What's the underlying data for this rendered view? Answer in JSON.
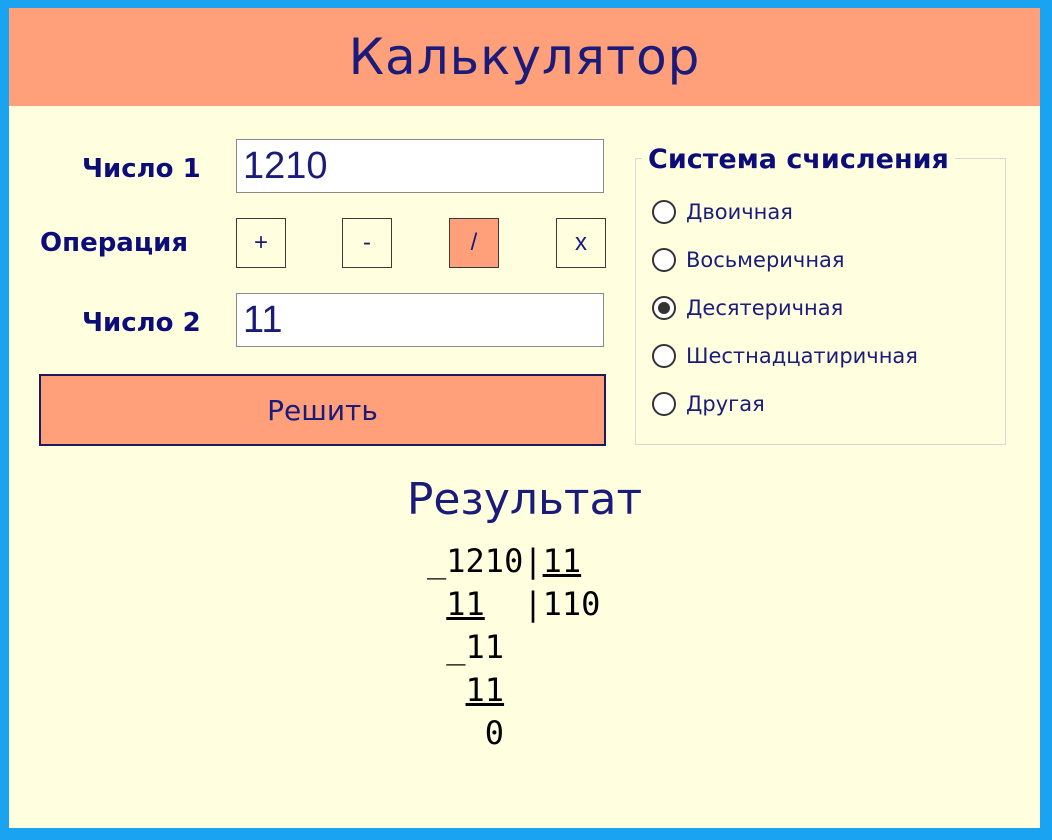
{
  "header": {
    "title": "Калькулятор"
  },
  "form": {
    "number1_label": "Число 1",
    "number1_value": "1210",
    "operation_label": "Операция",
    "operations": [
      "+",
      "-",
      "/",
      "x"
    ],
    "selected_operation": "/",
    "number2_label": "Число 2",
    "number2_value": "11",
    "solve_label": "Решить"
  },
  "numeral_system": {
    "legend": "Система счисления",
    "options": [
      "Двоичная",
      "Восьмеричная",
      "Десятеричная",
      "Шестнадцатиричная",
      "Другая"
    ],
    "selected": "Десятеричная"
  },
  "result": {
    "title": "Результат",
    "dividend": "1210",
    "divisor": "11",
    "quotient": "110",
    "steps": [
      "11",
      "11",
      "11",
      "0"
    ]
  },
  "colors": {
    "accent": "#ffa07a",
    "background": "#ffffe0",
    "text": "#1b1b7a",
    "frame": "#1aa3f0"
  }
}
